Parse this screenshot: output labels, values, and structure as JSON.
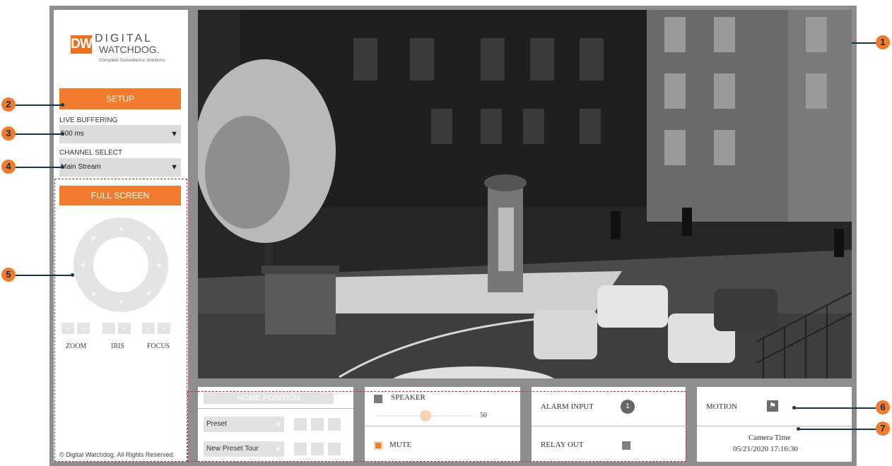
{
  "brand": {
    "logo_mark": "DW",
    "name_line1": "DIGITAL",
    "name_line2": "WATCHDOG.",
    "tagline": "Complete Surveillance Solutions"
  },
  "sidebar": {
    "setup_label": "SETUP",
    "live_buffering_label": "LIVE BUFFERING",
    "live_buffering_value": "500 ms",
    "channel_select_label": "CHANNEL SELECT",
    "channel_select_value": "Main Stream",
    "full_screen_label": "FULL SCREEN",
    "zoom_label": "ZOOM",
    "iris_label": "IRIS",
    "focus_label": "FOCUS",
    "copyright": "© Digital Watchdog. All Rights Reserved."
  },
  "preset_panel": {
    "home_position_label": "HOME POSITION",
    "preset_value": "Preset",
    "preset_tour_value": "New Preset Tour"
  },
  "audio_panel": {
    "speaker_label": "SPEAKER",
    "speaker_volume": "50",
    "speaker_volume_fraction": 0.5,
    "mute_label": "MUTE"
  },
  "io_panel": {
    "alarm_input_label": "ALARM INPUT",
    "alarm_input_number": "1",
    "relay_out_label": "RELAY OUT"
  },
  "status_panel": {
    "motion_label": "MOTION",
    "camera_time_label": "Camera Time",
    "camera_time_value": "05/21/2020 17:16:30"
  },
  "callouts": [
    "1",
    "2",
    "3",
    "4",
    "5",
    "6",
    "7"
  ],
  "colors": {
    "accent_orange": "#f07b2c",
    "annotation_magenta": "#b0306a",
    "callout_line": "#1a3350"
  },
  "icons": {
    "motion": "running-person-icon",
    "ptz": "ptz-direction-dial-icon"
  }
}
